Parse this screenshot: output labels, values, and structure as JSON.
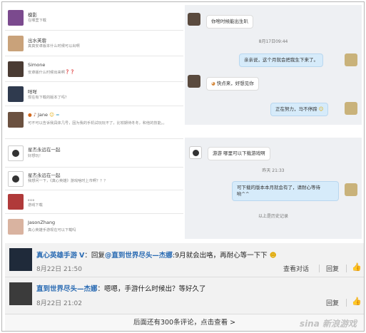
{
  "left_list": [
    {
      "name": "模影",
      "text": "在哪里下载"
    },
    {
      "name": "出水芙蓉",
      "text": "真真安卓版本什么时候可以出啊"
    },
    {
      "name": "Simone",
      "text": "安卓版什么时候出来啊",
      "marks": "？？"
    },
    {
      "name": "咩咩",
      "text": "现在有下载的版本了吗？"
    },
    {
      "name": "Jane",
      "text": "可不可以告诉我具体几号，因为我的手机试玩玩不了，比较期待冬冬，和他的技能。。"
    },
    {
      "name": "星杰永远在一起",
      "text": "好想玩！"
    },
    {
      "name": "星杰永远在一起",
      "text": "我想问一下，《真心英雄》游戏啥时上市啊？？？"
    },
    {
      "name": "。。。",
      "text": "游戏下载"
    },
    {
      "name": "JasonZhang",
      "text": "真心英雄手游现在可以下载吗"
    }
  ],
  "chat1": {
    "msg1": "你啥时候能出生叭",
    "time1": "8月17日09:44",
    "msg2": "亲亲说，这个月就会把我生下来了。",
    "msg3": "快点来，好想见你",
    "msg4": "正在努力，马不停蹄"
  },
  "chat2": {
    "msg1": "游游 哪里可以下载游戏啊",
    "time1": "昨天 21:33",
    "msg2_line1": "可下载的版本本月就会有了，请耐心等待",
    "msg2_line2": "哟^^",
    "history": "以上是历史记录"
  },
  "comments": [
    {
      "name": "真心英雄手游",
      "verified": "V",
      "reply_prefix": "：回复",
      "mention": "@直到世界尽头—杰娜",
      "body": ":9月就会出咯，再耐心等一下下",
      "time": "8月22日 21:50",
      "view_dialog": "查看对话",
      "reply": "回复"
    },
    {
      "name": "直到世界尽头—杰娜",
      "body": "：嗯嗯，手游什么时候出？等好久了",
      "time": "8月22日 21:02",
      "reply": "回复"
    }
  ],
  "footer": {
    "more": "后面还有300条评论，点击查看 >"
  },
  "watermark": "sina 新浪游戏",
  "colors": {
    "link": "#2a6bb3",
    "chat_bg": "#eef0f3",
    "bubble_blue": "#d6ebfa"
  }
}
